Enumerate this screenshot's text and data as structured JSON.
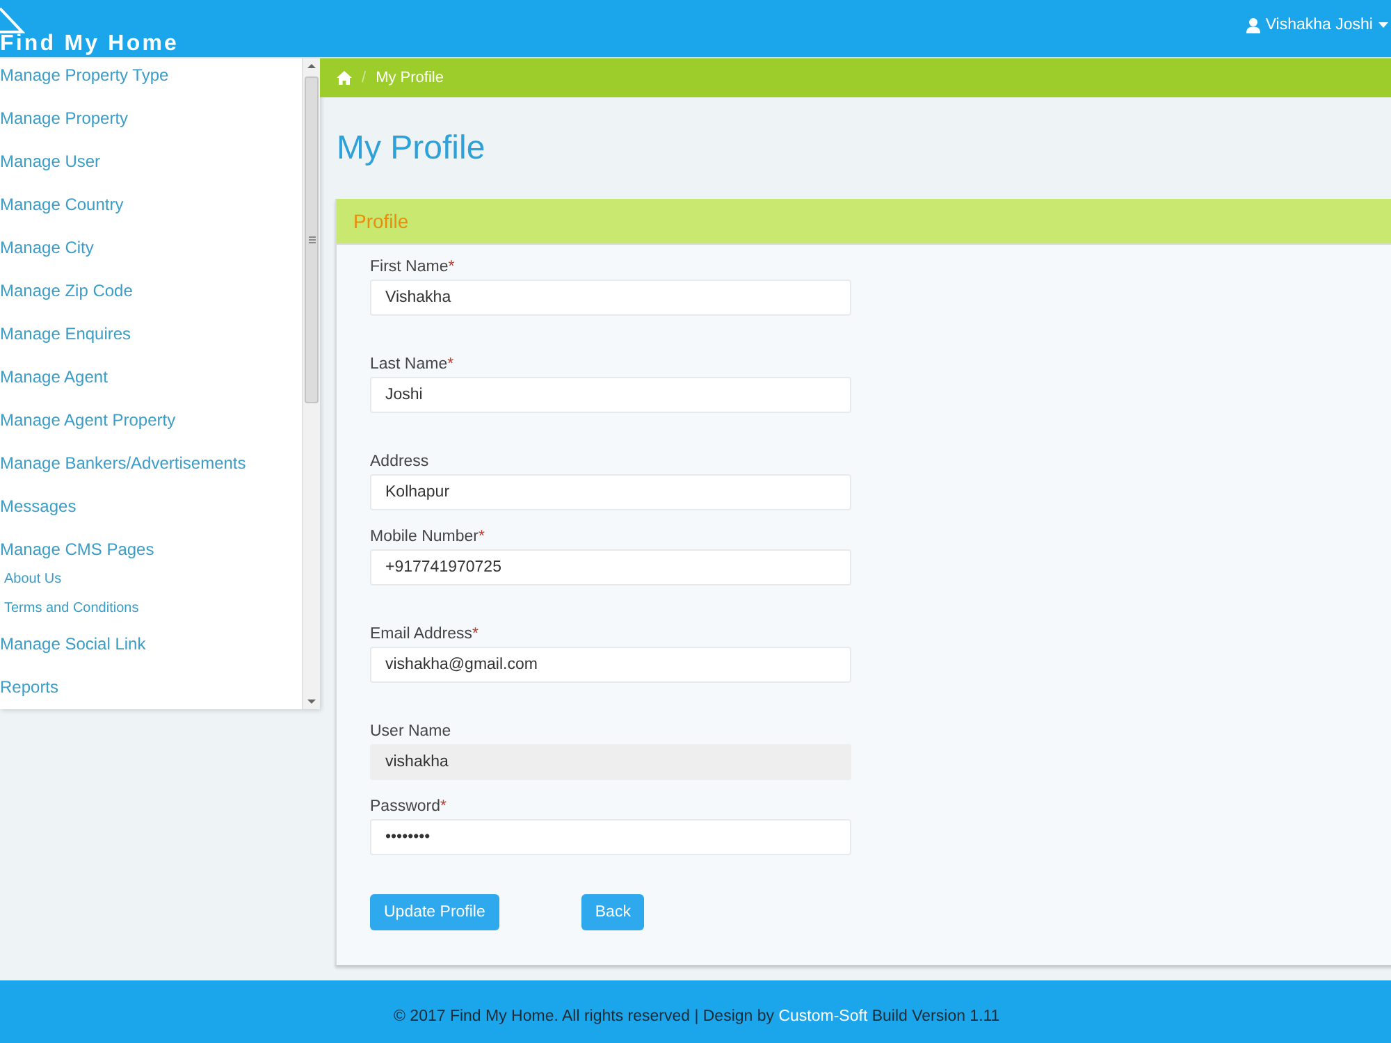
{
  "header": {
    "logo": "Find My Home",
    "user": "Vishakha Joshi"
  },
  "sidebar": {
    "items": [
      {
        "label": "Manage Property Type"
      },
      {
        "label": "Manage Property"
      },
      {
        "label": "Manage User"
      },
      {
        "label": "Manage Country"
      },
      {
        "label": "Manage City"
      },
      {
        "label": "Manage Zip Code"
      },
      {
        "label": "Manage Enquires"
      },
      {
        "label": "Manage Agent"
      },
      {
        "label": "Manage Agent Property"
      },
      {
        "label": "Manage Bankers/Advertisements"
      },
      {
        "label": "Messages"
      },
      {
        "label": "Manage CMS Pages",
        "children": [
          {
            "label": "About Us"
          },
          {
            "label": "Terms and Conditions"
          }
        ]
      },
      {
        "label": "Manage Social Link"
      },
      {
        "label": "Reports"
      }
    ]
  },
  "breadcrumb": {
    "separator": "/",
    "current": "My Profile"
  },
  "page_title": "My Profile",
  "panel": {
    "title": "Profile",
    "fields": [
      {
        "label": "First Name",
        "required_mark": "*",
        "value": "Vishakha",
        "disabled": false
      },
      {
        "label": "Last Name",
        "required_mark": "*",
        "value": "Joshi",
        "disabled": false
      },
      {
        "label": "Address",
        "value": "Kolhapur",
        "disabled": false
      },
      {
        "label": "Mobile Number",
        "required_mark": "*",
        "value": "+917741970725",
        "disabled": false
      },
      {
        "label": "Email Address",
        "required_mark": "*",
        "value": "vishakha@gmail.com",
        "disabled": false
      },
      {
        "label": "User Name",
        "value": "vishakha",
        "disabled": true
      },
      {
        "label": "Password",
        "required_mark": "*",
        "value": "••••••••",
        "disabled": false
      }
    ],
    "buttons": [
      {
        "label": "Update Profile"
      },
      {
        "label": "Back"
      }
    ]
  },
  "footer": {
    "text_before": "© 2017 Find My Home. All rights reserved | Design by",
    "link": "Custom-Soft",
    "text_after": "Build Version 1.11"
  }
}
